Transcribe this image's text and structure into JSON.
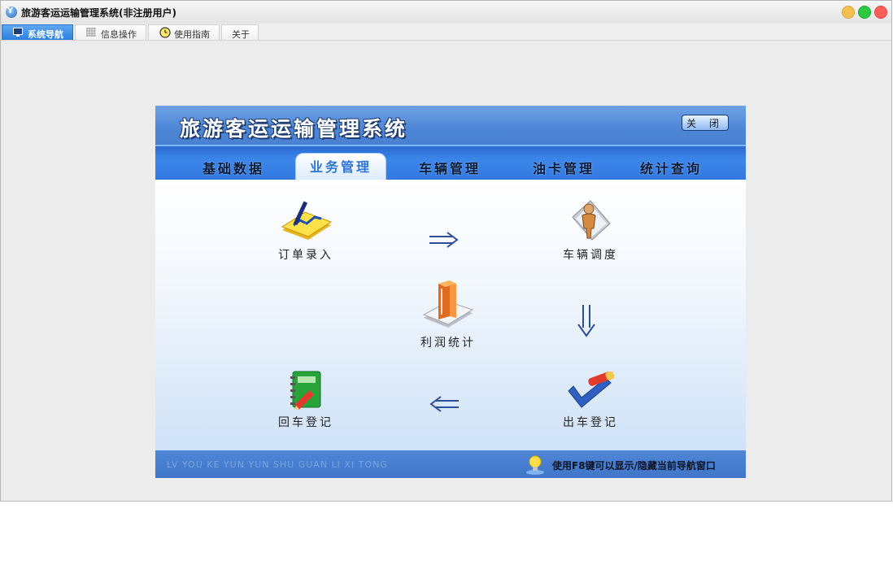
{
  "window": {
    "title": "旅游客运运输管理系统(非注册用户)",
    "controls": {
      "minimize_color": "#f5bf4f",
      "maximize_color": "#2bc840",
      "close_color": "#ff5f57"
    }
  },
  "tabs": [
    {
      "label": "系统导航",
      "icon": "monitor-icon",
      "active": true
    },
    {
      "label": "信息操作",
      "icon": "grid-icon",
      "active": false
    },
    {
      "label": "使用指南",
      "icon": "clock-icon",
      "active": false
    },
    {
      "label": "关于",
      "icon": "",
      "active": false
    }
  ],
  "panel": {
    "title": "旅游客运运输管理系统",
    "close_label": "关 闭",
    "menu": [
      {
        "label": "基础数据",
        "active": false
      },
      {
        "label": "业务管理",
        "active": true
      },
      {
        "label": "车辆管理",
        "active": false
      },
      {
        "label": "油卡管理",
        "active": false
      },
      {
        "label": "统计查询",
        "active": false
      }
    ],
    "nodes": {
      "order_entry": {
        "label": "订单录入",
        "icon": "order-pencil-icon"
      },
      "vehicle_dispatch": {
        "label": "车辆调度",
        "icon": "person-dispatch-icon"
      },
      "profit_stats": {
        "label": "利润统计",
        "icon": "book-icon"
      },
      "return_register": {
        "label": "回车登记",
        "icon": "notebook-pencil-icon"
      },
      "departure_register": {
        "label": "出车登记",
        "icon": "check-pen-icon"
      }
    },
    "footer": {
      "pinyin": "LV YOU KE YUN YUN SHU GUAN LI XI TONG",
      "hint": "使用F8键可以显示/隐藏当前导航窗口",
      "icon": "lightbulb-icon"
    },
    "colors": {
      "header": "#4e86d6",
      "menu": "#3278e0",
      "active_menu_text": "#2d76d8"
    }
  }
}
